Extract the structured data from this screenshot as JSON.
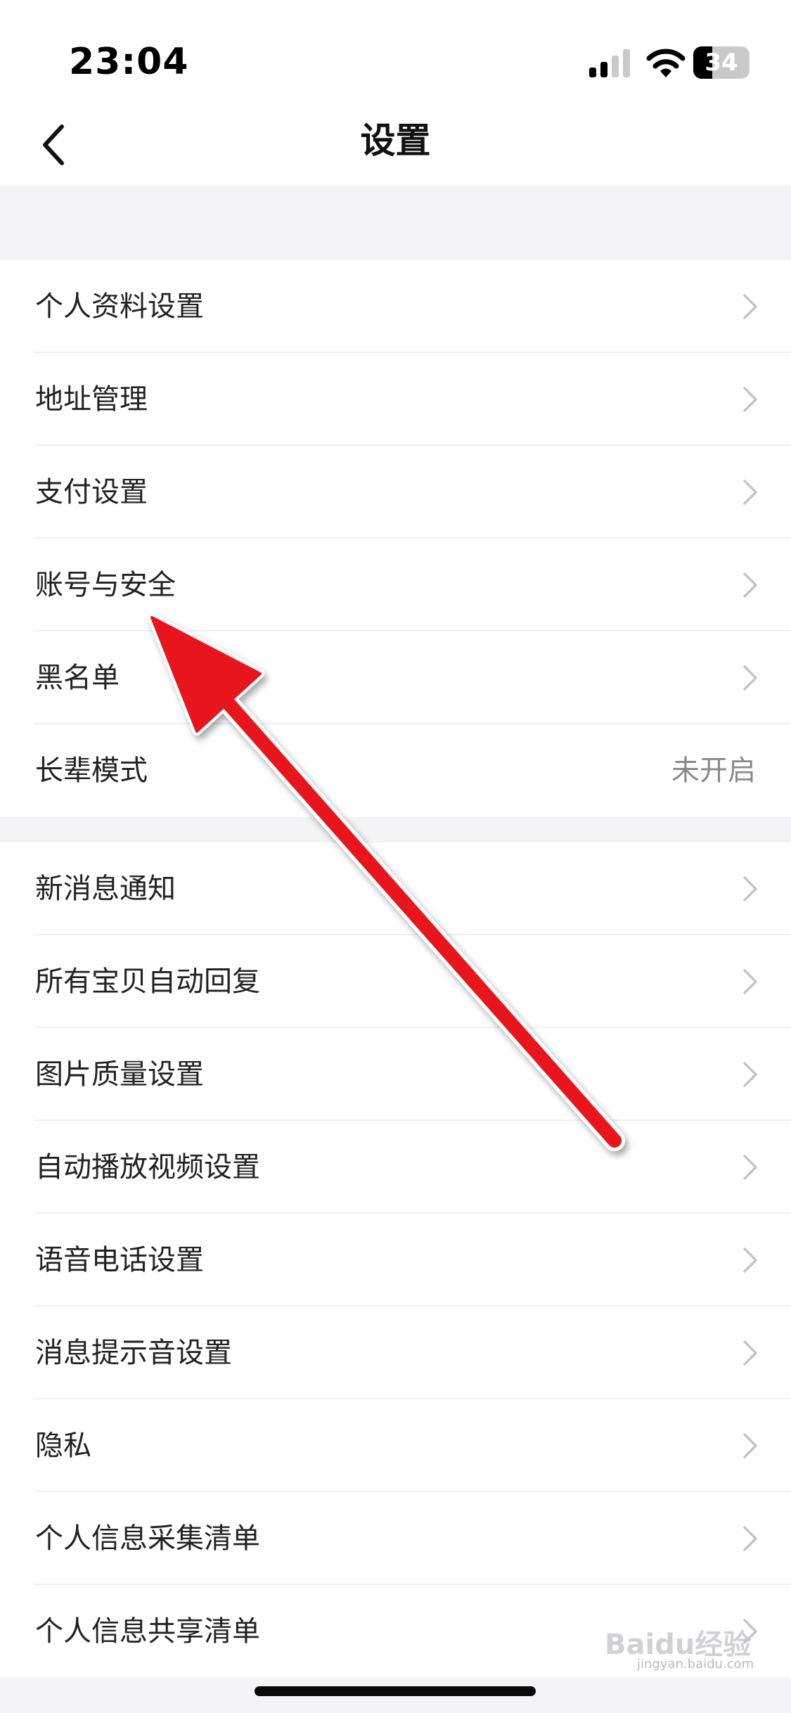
{
  "status": {
    "time": "23:04",
    "battery_level": "34",
    "battery_fraction": 0.34
  },
  "nav": {
    "title": "设置",
    "back_icon": "chevron-left-icon"
  },
  "groups": [
    {
      "items": [
        {
          "label": "个人资料设置",
          "icon": "chevron-right-icon"
        },
        {
          "label": "地址管理",
          "icon": "chevron-right-icon"
        },
        {
          "label": "支付设置",
          "icon": "chevron-right-icon"
        },
        {
          "label": "账号与安全",
          "icon": "chevron-right-icon"
        },
        {
          "label": "黑名单",
          "icon": "chevron-right-icon"
        },
        {
          "label": "长辈模式",
          "value": "未开启"
        }
      ]
    },
    {
      "items": [
        {
          "label": "新消息通知",
          "icon": "chevron-right-icon"
        },
        {
          "label": "所有宝贝自动回复",
          "icon": "chevron-right-icon"
        },
        {
          "label": "图片质量设置",
          "icon": "chevron-right-icon"
        },
        {
          "label": "自动播放视频设置",
          "icon": "chevron-right-icon"
        },
        {
          "label": "语音电话设置",
          "icon": "chevron-right-icon"
        },
        {
          "label": "消息提示音设置",
          "icon": "chevron-right-icon"
        },
        {
          "label": "隐私",
          "icon": "chevron-right-icon"
        },
        {
          "label": "个人信息采集清单",
          "icon": "chevron-right-icon"
        },
        {
          "label": "个人信息共享清单",
          "icon": "chevron-right-icon"
        }
      ]
    }
  ],
  "annotation": {
    "color": "#e8141b",
    "points_to": "账号与安全"
  },
  "watermark": {
    "text": "Baidu经验",
    "sub": "jingyan.baidu.com"
  },
  "colors": {
    "section_gap": "#f4f4f6",
    "chevron": "#c4c4c6",
    "secondary_text": "#8a8a8a"
  }
}
